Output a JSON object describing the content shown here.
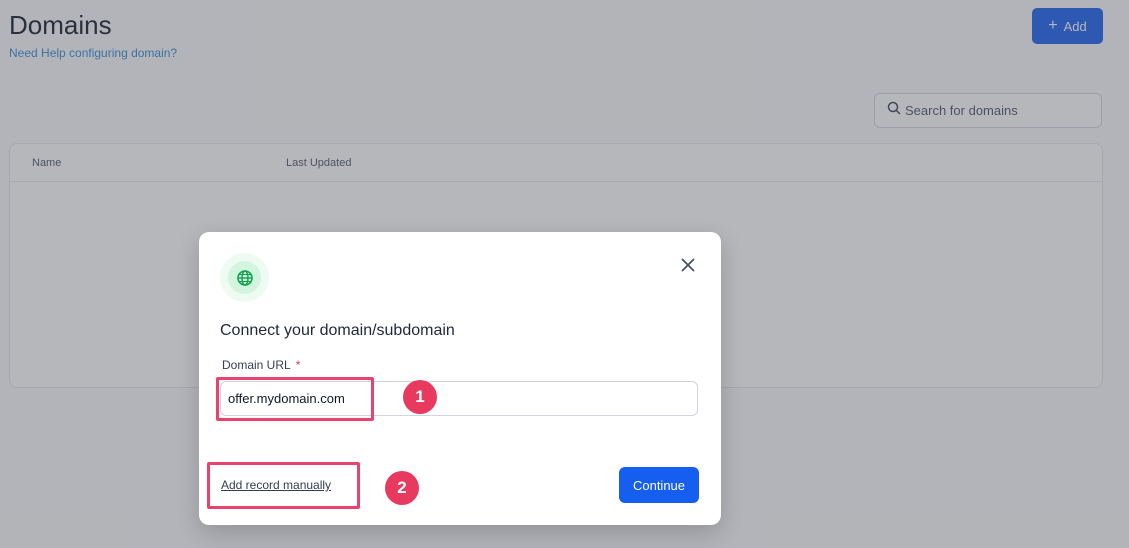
{
  "page": {
    "title": "Domains",
    "help_link": "Need Help configuring domain?",
    "add_button": {
      "icon": "plus-icon",
      "label": "Add"
    },
    "search": {
      "placeholder": "Search for domains",
      "icon": "search-icon"
    },
    "table": {
      "columns": [
        "Name",
        "Last Updated"
      ]
    }
  },
  "modal": {
    "icon": "globe-icon",
    "title": "Connect your domain/subdomain",
    "field_label": "Domain URL",
    "required_mark": "*",
    "field_value": "offer.mydomain.com",
    "manual_link": "Add record manually",
    "continue_label": "Continue",
    "close_icon": "close-icon"
  },
  "annotations": {
    "step1": "1",
    "step2": "2",
    "color": "#e7436e"
  },
  "colors": {
    "primary": "#155eef",
    "link": "#2e8bd6",
    "globe_bg": "#d3f5df",
    "globe_stroke": "#12a150"
  }
}
